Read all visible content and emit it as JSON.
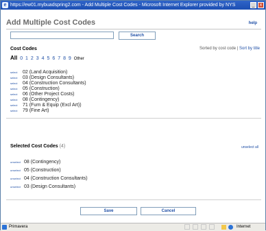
{
  "window": {
    "title": "https://ew01.mybuadspring2.com - Add Multiple Cost Codes - Microsoft Internet Explorer provided by NYS ...",
    "minimize": "_",
    "close": "x"
  },
  "header": {
    "title": "Add Multiple Cost Codes",
    "help": "help"
  },
  "search": {
    "value": "",
    "placeholder": "",
    "button": "Search"
  },
  "cost_codes": {
    "heading": "Cost Codes",
    "sort_text": "Sorted by cost code",
    "sort_link": "Sort by title",
    "filters": [
      "All",
      "0",
      "1",
      "2",
      "3",
      "4",
      "5",
      "6",
      "7",
      "8",
      "9",
      "Other"
    ],
    "items": [
      {
        "action": "select",
        "label": "02 (Land Acquisition)"
      },
      {
        "action": "select",
        "label": "03 (Design Consultants)"
      },
      {
        "action": "select",
        "label": "04 (Construction Consultants)"
      },
      {
        "action": "select",
        "label": "05 (Construction)"
      },
      {
        "action": "select",
        "label": "06 (Other Project Costs)"
      },
      {
        "action": "select",
        "label": "08 (Contingency)"
      },
      {
        "action": "select",
        "label": "71 (Furn & Equip (Excl Art))"
      },
      {
        "action": "select",
        "label": "79 (Fine Art)"
      }
    ]
  },
  "selected": {
    "heading": "Selected Cost Codes",
    "count": "(4)",
    "unselect_all": "unselect all",
    "items": [
      {
        "action": "unselect",
        "label": "08 (Contingency)"
      },
      {
        "action": "unselect",
        "label": "05 (Construction)"
      },
      {
        "action": "unselect",
        "label": "04 (Construction Consultants)"
      },
      {
        "action": "unselect",
        "label": "03 (Design Consultants)"
      }
    ]
  },
  "footer": {
    "save": "Save",
    "cancel": "Cancel"
  },
  "statusbar": {
    "left_text": "Primavera",
    "zone": "Internet"
  }
}
